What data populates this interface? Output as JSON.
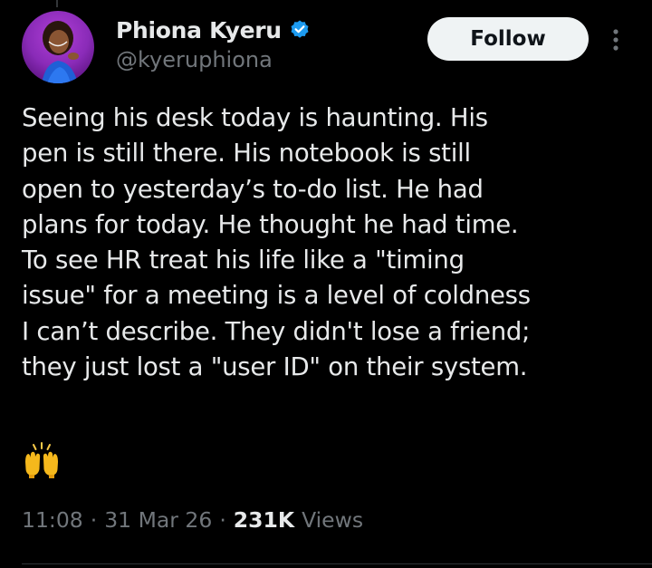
{
  "author": {
    "name": "Phiona Kyeru",
    "handle": "@kyeruphiona",
    "verified": true,
    "verified_color": "#1d9bf0"
  },
  "actions": {
    "follow_label": "Follow",
    "more_icon": "more-vertical-icon"
  },
  "post": {
    "lines": [
      "Seeing his desk today is haunting. His",
      "pen is still there. His notebook is still",
      "open to yesterday’s to-do list. He had",
      "plans for today. He thought he had time.",
      "To see HR treat his life like a \"timing",
      "issue\" for a meeting is a level of coldness",
      "I can’t describe. They didn't lose a friend;",
      "they just lost a \"user ID\" on their system."
    ],
    "emoji": "raising-hands-emoji"
  },
  "meta": {
    "time": "11:08",
    "date": "31 Mar 26",
    "views_count": "231K",
    "views_label": "Views",
    "separator": "·"
  },
  "colors": {
    "background": "#000000",
    "text_primary": "#e7e9ea",
    "text_secondary": "#71767b",
    "button_bg": "#eff3f4",
    "button_text": "#0f1419"
  }
}
